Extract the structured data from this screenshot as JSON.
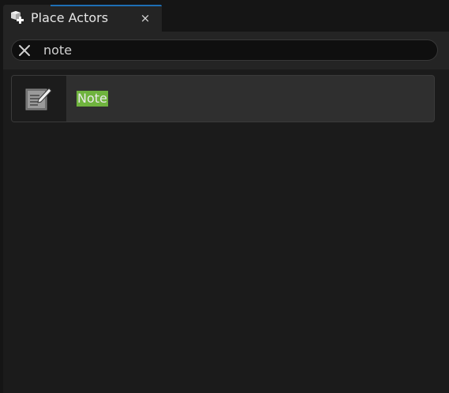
{
  "tab": {
    "title": "Place Actors",
    "close_glyph": "×",
    "icon": "place-actors-icon",
    "accent_color": "#1e6fb5"
  },
  "search": {
    "value": "note",
    "clear_icon": "close-icon"
  },
  "results": [
    {
      "label": "Note",
      "icon": "note-icon",
      "highlight_color": "#6fb33e"
    }
  ]
}
